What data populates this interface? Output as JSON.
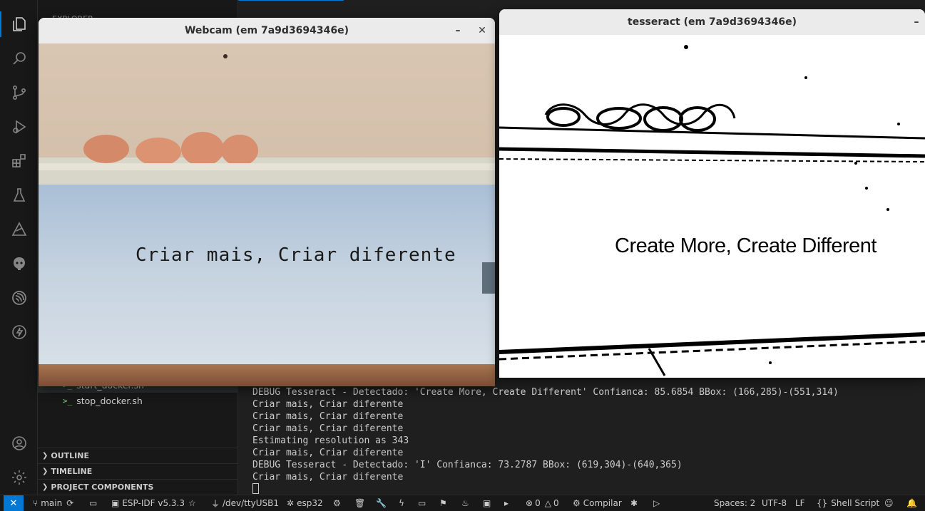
{
  "activity_bar": {
    "icons": [
      "explorer-icon",
      "search-icon",
      "source-control-icon",
      "run-debug-icon",
      "extensions-icon",
      "testing-icon",
      "remote-icon",
      "platformio-icon",
      "espressif-icon",
      "flash-icon"
    ],
    "bottom_icons": [
      "account-icon",
      "settings-icon"
    ]
  },
  "sidebar": {
    "header": "EXPLORER",
    "files": [
      {
        "name": "start_docker.sh"
      },
      {
        "name": "stop_docker.sh"
      }
    ],
    "sections": [
      {
        "label": "OUTLINE"
      },
      {
        "label": "TIMELINE"
      },
      {
        "label": "PROJECT COMPONENTS"
      }
    ]
  },
  "terminal": {
    "lines": [
      "DEBUG Tesseract - Detectado: 'Create More, Create Different' Confianca: 85.6854 BBox: (166,285)-(551,314)",
      "Criar mais, Criar diferente",
      "Criar mais, Criar diferente",
      "Criar mais, Criar diferente",
      "Estimating resolution as 343",
      "Criar mais, Criar diferente",
      "DEBUG Tesseract - Detectado: 'I' Confianca: 73.2787 BBox: (619,304)-(640,365)",
      "Criar mais, Criar diferente"
    ]
  },
  "webcam_window": {
    "title": "Webcam (em 7a9d3694346e)",
    "overlay_text": "Criar mais, Criar diferente",
    "minimize": "–",
    "close": "✕"
  },
  "tesseract_window": {
    "title": "tesseract (em 7a9d3694346e)",
    "image_text": "Create More, Create Different",
    "minimize": "–"
  },
  "status_bar": {
    "branch": "main",
    "idf_version": "ESP-IDF v5.3.3",
    "port": "/dev/ttyUSB1",
    "target": "esp32",
    "errors": "0",
    "warnings": "0",
    "build_label": "Compilar",
    "spaces": "Spaces: 2",
    "encoding": "UTF-8",
    "eol": "LF",
    "language": "Shell Script"
  },
  "colors": {
    "accent": "#0078d4",
    "terminal_bg": "#1f1f1f",
    "sidebar_bg": "#181818"
  }
}
